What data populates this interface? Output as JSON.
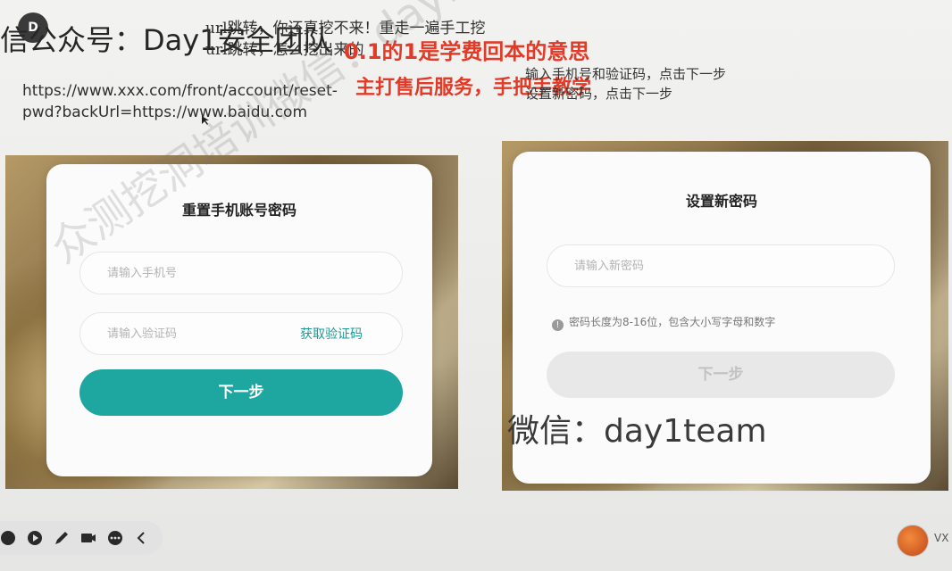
{
  "slide": {
    "title": "信公众号：Day1安全团队",
    "logo_text": "D"
  },
  "overlay_heading": {
    "line1": "url跳转，你还真挖不来！重走一遍手工挖",
    "line2": "url跳转，怎么挖出来的"
  },
  "notes": {
    "red_line_1": "0.1的1是学费回本的意思",
    "red_line_2": "主打售后服务，手把手教学"
  },
  "example_url": "https://www.xxx.com/front/account/reset-pwd?backUrl=https://www.baidu.com",
  "steps": {
    "line1": "输入手机号和验证码，点击下一步",
    "line2": "设置新密码，点击下一步"
  },
  "left_card": {
    "title": "重置手机账号密码",
    "phone_placeholder": "请输入手机号",
    "code_placeholder": "请输入验证码",
    "get_code_label": "获取验证码",
    "next_label": "下一步",
    "next_color": "#1ea6a0"
  },
  "right_card": {
    "title": "设置新密码",
    "password_placeholder": "请输入新密码",
    "hint": "密码长度为8-16位，包含大小写字母和数字",
    "next_label": "下一步"
  },
  "wechat_label": "微信：day1team",
  "watermark": "众测挖洞培训微信：day1team",
  "toolbar": {
    "icons": [
      "record-icon",
      "play-icon",
      "pen-icon",
      "camera-icon",
      "more-icon",
      "collapse-icon"
    ]
  },
  "avatar_label": "VX"
}
